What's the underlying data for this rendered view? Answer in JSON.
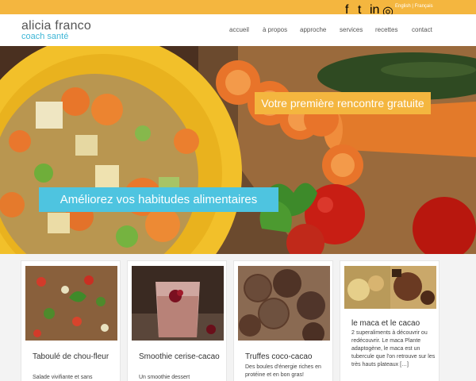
{
  "topbar": {
    "social": [
      {
        "name": "facebook-icon",
        "glyph": "f"
      },
      {
        "name": "twitter-icon",
        "glyph": "t"
      },
      {
        "name": "linkedin-icon",
        "glyph": "in"
      },
      {
        "name": "instagram-icon",
        "glyph": "◎"
      }
    ],
    "language": "English | Français"
  },
  "header": {
    "logo_name": "alicia franco",
    "logo_sub": "coach santé",
    "nav": [
      "accueil",
      "à propos",
      "approche",
      "services",
      "recettes",
      "contact"
    ]
  },
  "hero": {
    "cta_banner": "Votre première rencontre gratuite",
    "headline_banner": "Améliorez vos habitudes alimentaires"
  },
  "cards": [
    {
      "title": "Taboulé de chou-fleur",
      "desc": "Salade vivifiante et sans"
    },
    {
      "title": "Smoothie cerise-cacao",
      "desc": "Un smoothie dessert"
    },
    {
      "title": "Truffes coco-cacao",
      "desc": "Des boules d'énergie riches en protéine et en bon gras!"
    },
    {
      "title": "le maca et le cacao",
      "desc": "2 superaliments à découvrir ou redécouvrir. Le maca Plante adaptogène, le maca est un tubercule que l'on retrouve sur les très hauts plateaux […]"
    }
  ],
  "colors": {
    "accent_yellow": "#f4b63f",
    "accent_blue": "#4ec4e0",
    "logo_blue": "#3fb6d6"
  }
}
